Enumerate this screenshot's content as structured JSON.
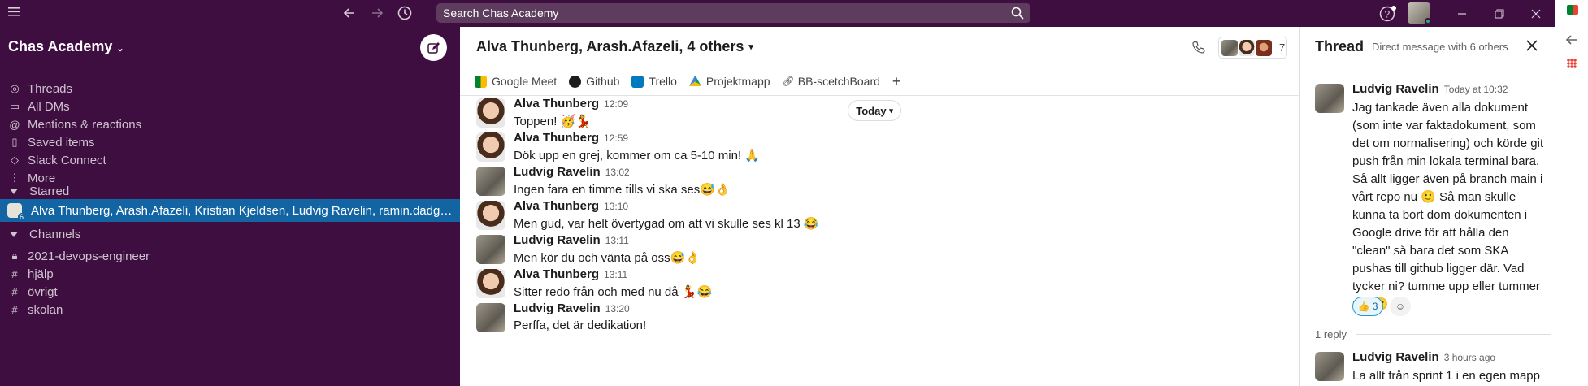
{
  "topbar": {
    "search_placeholder": "Search Chas Academy"
  },
  "sidebar": {
    "workspace": "Chas Academy",
    "nav": [
      {
        "label": "Threads",
        "icon": "threads-icon"
      },
      {
        "label": "All DMs",
        "icon": "dms-icon"
      },
      {
        "label": "Mentions & reactions",
        "icon": "at-icon"
      },
      {
        "label": "Saved items",
        "icon": "bookmark-icon"
      },
      {
        "label": "Slack Connect",
        "icon": "connect-icon"
      },
      {
        "label": "More",
        "icon": "more-icon"
      }
    ],
    "starred_label": "Starred",
    "starred_item": "Alva Thunberg, Arash.Afazeli, Kristian Kjeldsen, Ludvig Ravelin, ramin.dadg…",
    "starred_badge": "6",
    "channels_label": "Channels",
    "channels": [
      "2021-devops-engineer",
      "hjälp",
      "övrigt",
      "skolan"
    ]
  },
  "channel": {
    "title": "Alva Thunberg, Arash.Afazeli, 4 others",
    "member_count": "7",
    "bookmarks": [
      "Google Meet",
      "Github",
      "Trello",
      "Projektmapp",
      "BB-scetchBoard"
    ],
    "add_bookmark": "+",
    "today_label": "Today"
  },
  "messages": [
    {
      "name": "Alva Thunberg",
      "time": "12:09",
      "text": "Toppen! 🥳💃",
      "avatar": "alva"
    },
    {
      "name": "Alva Thunberg",
      "time": "12:59",
      "text": "Dök upp en grej, kommer om ca 5-10 min! 🙏",
      "avatar": "alva"
    },
    {
      "name": "Ludvig Ravelin",
      "time": "13:02",
      "text": "Ingen fara en timme tills vi ska ses😅👌",
      "avatar": "ludvig"
    },
    {
      "name": "Alva Thunberg",
      "time": "13:10",
      "text": "Men gud, var helt övertygad om att vi skulle ses kl 13 😂",
      "avatar": "alva"
    },
    {
      "name": "Ludvig Ravelin",
      "time": "13:11",
      "text": "Men kör du och vänta på oss😅👌",
      "avatar": "ludvig"
    },
    {
      "name": "Alva Thunberg",
      "time": "13:11",
      "text": "Sitter redo från och med nu då 💃😂",
      "avatar": "alva"
    },
    {
      "name": "Ludvig Ravelin",
      "time": "13:20",
      "text": "Perffa, det är dedikation!",
      "avatar": "ludvig"
    }
  ],
  "thread": {
    "title": "Thread",
    "subtitle": "Direct message with 6 others",
    "parent": {
      "name": "Ludvig Ravelin",
      "time": "Today at 10:32",
      "text": "Jag tankade även alla dokument (som inte var faktadokument, som det om normalisering) och körde git push från min lokala terminal bara. Så allt ligger även på branch main i vårt repo nu 🙂 Så man skulle kunna ta bort dom dokumenten i Google drive för att hålla den \"clean\" så bara det som SKA pushas till github ligger där. Vad tycker ni? tumme upp eller tummer ner 🙂",
      "reaction": "👍 3"
    },
    "replies_label": "1 reply",
    "reply": {
      "name": "Ludvig Ravelin",
      "time": "3 hours ago",
      "text": "La allt från sprint 1 i en egen mapp"
    }
  },
  "colors": {
    "sidebar": "#3f0e40",
    "active": "#1264a3",
    "accent": "#1d9bd1"
  }
}
